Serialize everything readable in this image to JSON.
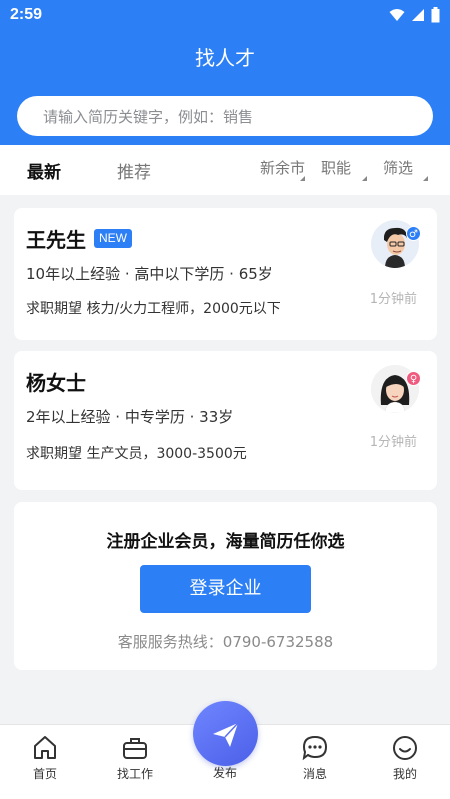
{
  "status_bar": {
    "time": "2:59"
  },
  "header": {
    "title": "找人才"
  },
  "search": {
    "placeholder": "请输入简历关键字，例如：销售"
  },
  "tabs": {
    "latest": "最新",
    "recommended": "推荐"
  },
  "filters": {
    "city": "新余市",
    "function": "职能",
    "filter": "筛选"
  },
  "candidates": [
    {
      "name": "王先生",
      "badge": "NEW",
      "meta": "10年以上经验 · 高中以下学历 · 65岁",
      "expectation": "求职期望 核力/火力工程师，2000元以下",
      "time_ago": "1分钟前",
      "gender": "male"
    },
    {
      "name": "杨女士",
      "meta": "2年以上经验 · 中专学历 · 33岁",
      "expectation": "求职期望 生产文员，3000-3500元",
      "time_ago": "1分钟前",
      "gender": "female"
    }
  ],
  "promo": {
    "text": "注册企业会员，海量简历任你选",
    "button": "登录企业",
    "hotline": "客服服务热线：0790-6732588"
  },
  "bottom_nav": {
    "home": "首页",
    "find_job": "找工作",
    "publish": "发布",
    "messages": "消息",
    "mine": "我的"
  },
  "colors": {
    "primary": "#2d7ff5",
    "male": "#2d7ff5",
    "female": "#f05a7e",
    "publish": "#5b6ff0"
  }
}
